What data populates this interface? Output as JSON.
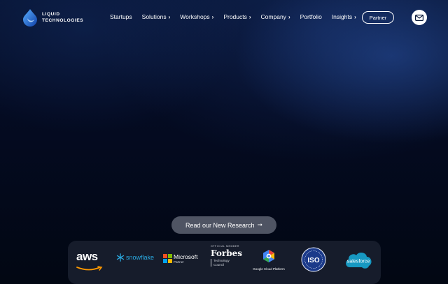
{
  "brand": {
    "line1": "LIQUID",
    "line2": "TECHNOLOGIES"
  },
  "nav": {
    "items": [
      {
        "label": "Startups",
        "has_chevron": false
      },
      {
        "label": "Solutions",
        "has_chevron": true
      },
      {
        "label": "Workshops",
        "has_chevron": true
      },
      {
        "label": "Products",
        "has_chevron": true
      },
      {
        "label": "Company",
        "has_chevron": true
      },
      {
        "label": "Portfolio",
        "has_chevron": false
      },
      {
        "label": "Insights",
        "has_chevron": true
      }
    ],
    "chevron": "›",
    "partner_label": "Partner",
    "mail_icon": "envelope-icon"
  },
  "cta": {
    "label": "Read our New Research",
    "arrow": "➞"
  },
  "partners": {
    "aws": "aws",
    "snowflake": "snowflake",
    "microsoft": {
      "name": "Microsoft",
      "sub": "Partner"
    },
    "forbes": {
      "kicker": "OFFICIAL MEMBER",
      "name": "Forbes",
      "sub1": "Technology",
      "sub2": "Council"
    },
    "gcp": "Google Cloud Platform",
    "iso": "ISO",
    "salesforce": "salesforce"
  },
  "colors": {
    "background": "#020713",
    "accent_blue": "#1f6fd6",
    "snowflake": "#2aa9e0",
    "salesforce": "#1798c1",
    "aws_orange": "#ff9900",
    "iso_blue": "#1b3a8a"
  }
}
